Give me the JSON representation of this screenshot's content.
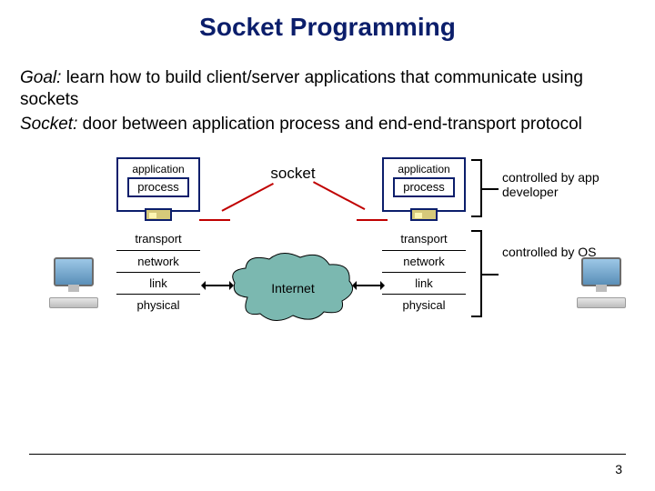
{
  "title": "Socket Programming",
  "intro": {
    "goal_label": "Goal:",
    "goal_text": " learn how to build client/server applications that communicate using sockets",
    "socket_label": "Socket:",
    "socket_text": " door between application process and end-end-transport protocol"
  },
  "diagram": {
    "socket_header": "socket",
    "cloud_label": "Internet",
    "stack_left": {
      "application": "application",
      "process": "process",
      "layers": [
        "transport",
        "network",
        "link",
        "physical"
      ]
    },
    "stack_right": {
      "application": "application",
      "process": "process",
      "layers": [
        "transport",
        "network",
        "link",
        "physical"
      ]
    },
    "annot_dev": "controlled by app developer",
    "annot_os": "controlled by OS"
  },
  "page_number": "3"
}
